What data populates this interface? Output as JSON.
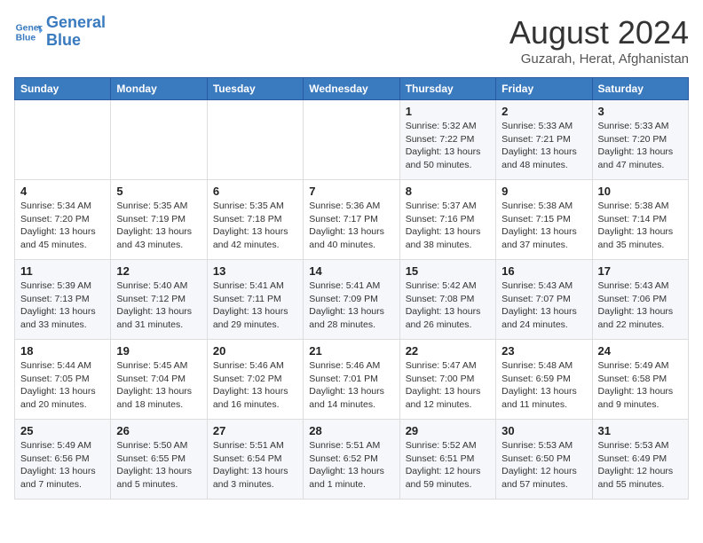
{
  "logo": {
    "line1": "General",
    "line2": "Blue"
  },
  "title": "August 2024",
  "subtitle": "Guzarah, Herat, Afghanistan",
  "days_of_week": [
    "Sunday",
    "Monday",
    "Tuesday",
    "Wednesday",
    "Thursday",
    "Friday",
    "Saturday"
  ],
  "weeks": [
    [
      {
        "day": "",
        "info": ""
      },
      {
        "day": "",
        "info": ""
      },
      {
        "day": "",
        "info": ""
      },
      {
        "day": "",
        "info": ""
      },
      {
        "day": "1",
        "info": "Sunrise: 5:32 AM\nSunset: 7:22 PM\nDaylight: 13 hours\nand 50 minutes."
      },
      {
        "day": "2",
        "info": "Sunrise: 5:33 AM\nSunset: 7:21 PM\nDaylight: 13 hours\nand 48 minutes."
      },
      {
        "day": "3",
        "info": "Sunrise: 5:33 AM\nSunset: 7:20 PM\nDaylight: 13 hours\nand 47 minutes."
      }
    ],
    [
      {
        "day": "4",
        "info": "Sunrise: 5:34 AM\nSunset: 7:20 PM\nDaylight: 13 hours\nand 45 minutes."
      },
      {
        "day": "5",
        "info": "Sunrise: 5:35 AM\nSunset: 7:19 PM\nDaylight: 13 hours\nand 43 minutes."
      },
      {
        "day": "6",
        "info": "Sunrise: 5:35 AM\nSunset: 7:18 PM\nDaylight: 13 hours\nand 42 minutes."
      },
      {
        "day": "7",
        "info": "Sunrise: 5:36 AM\nSunset: 7:17 PM\nDaylight: 13 hours\nand 40 minutes."
      },
      {
        "day": "8",
        "info": "Sunrise: 5:37 AM\nSunset: 7:16 PM\nDaylight: 13 hours\nand 38 minutes."
      },
      {
        "day": "9",
        "info": "Sunrise: 5:38 AM\nSunset: 7:15 PM\nDaylight: 13 hours\nand 37 minutes."
      },
      {
        "day": "10",
        "info": "Sunrise: 5:38 AM\nSunset: 7:14 PM\nDaylight: 13 hours\nand 35 minutes."
      }
    ],
    [
      {
        "day": "11",
        "info": "Sunrise: 5:39 AM\nSunset: 7:13 PM\nDaylight: 13 hours\nand 33 minutes."
      },
      {
        "day": "12",
        "info": "Sunrise: 5:40 AM\nSunset: 7:12 PM\nDaylight: 13 hours\nand 31 minutes."
      },
      {
        "day": "13",
        "info": "Sunrise: 5:41 AM\nSunset: 7:11 PM\nDaylight: 13 hours\nand 29 minutes."
      },
      {
        "day": "14",
        "info": "Sunrise: 5:41 AM\nSunset: 7:09 PM\nDaylight: 13 hours\nand 28 minutes."
      },
      {
        "day": "15",
        "info": "Sunrise: 5:42 AM\nSunset: 7:08 PM\nDaylight: 13 hours\nand 26 minutes."
      },
      {
        "day": "16",
        "info": "Sunrise: 5:43 AM\nSunset: 7:07 PM\nDaylight: 13 hours\nand 24 minutes."
      },
      {
        "day": "17",
        "info": "Sunrise: 5:43 AM\nSunset: 7:06 PM\nDaylight: 13 hours\nand 22 minutes."
      }
    ],
    [
      {
        "day": "18",
        "info": "Sunrise: 5:44 AM\nSunset: 7:05 PM\nDaylight: 13 hours\nand 20 minutes."
      },
      {
        "day": "19",
        "info": "Sunrise: 5:45 AM\nSunset: 7:04 PM\nDaylight: 13 hours\nand 18 minutes."
      },
      {
        "day": "20",
        "info": "Sunrise: 5:46 AM\nSunset: 7:02 PM\nDaylight: 13 hours\nand 16 minutes."
      },
      {
        "day": "21",
        "info": "Sunrise: 5:46 AM\nSunset: 7:01 PM\nDaylight: 13 hours\nand 14 minutes."
      },
      {
        "day": "22",
        "info": "Sunrise: 5:47 AM\nSunset: 7:00 PM\nDaylight: 13 hours\nand 12 minutes."
      },
      {
        "day": "23",
        "info": "Sunrise: 5:48 AM\nSunset: 6:59 PM\nDaylight: 13 hours\nand 11 minutes."
      },
      {
        "day": "24",
        "info": "Sunrise: 5:49 AM\nSunset: 6:58 PM\nDaylight: 13 hours\nand 9 minutes."
      }
    ],
    [
      {
        "day": "25",
        "info": "Sunrise: 5:49 AM\nSunset: 6:56 PM\nDaylight: 13 hours\nand 7 minutes."
      },
      {
        "day": "26",
        "info": "Sunrise: 5:50 AM\nSunset: 6:55 PM\nDaylight: 13 hours\nand 5 minutes."
      },
      {
        "day": "27",
        "info": "Sunrise: 5:51 AM\nSunset: 6:54 PM\nDaylight: 13 hours\nand 3 minutes."
      },
      {
        "day": "28",
        "info": "Sunrise: 5:51 AM\nSunset: 6:52 PM\nDaylight: 13 hours\nand 1 minute."
      },
      {
        "day": "29",
        "info": "Sunrise: 5:52 AM\nSunset: 6:51 PM\nDaylight: 12 hours\nand 59 minutes."
      },
      {
        "day": "30",
        "info": "Sunrise: 5:53 AM\nSunset: 6:50 PM\nDaylight: 12 hours\nand 57 minutes."
      },
      {
        "day": "31",
        "info": "Sunrise: 5:53 AM\nSunset: 6:49 PM\nDaylight: 12 hours\nand 55 minutes."
      }
    ]
  ]
}
